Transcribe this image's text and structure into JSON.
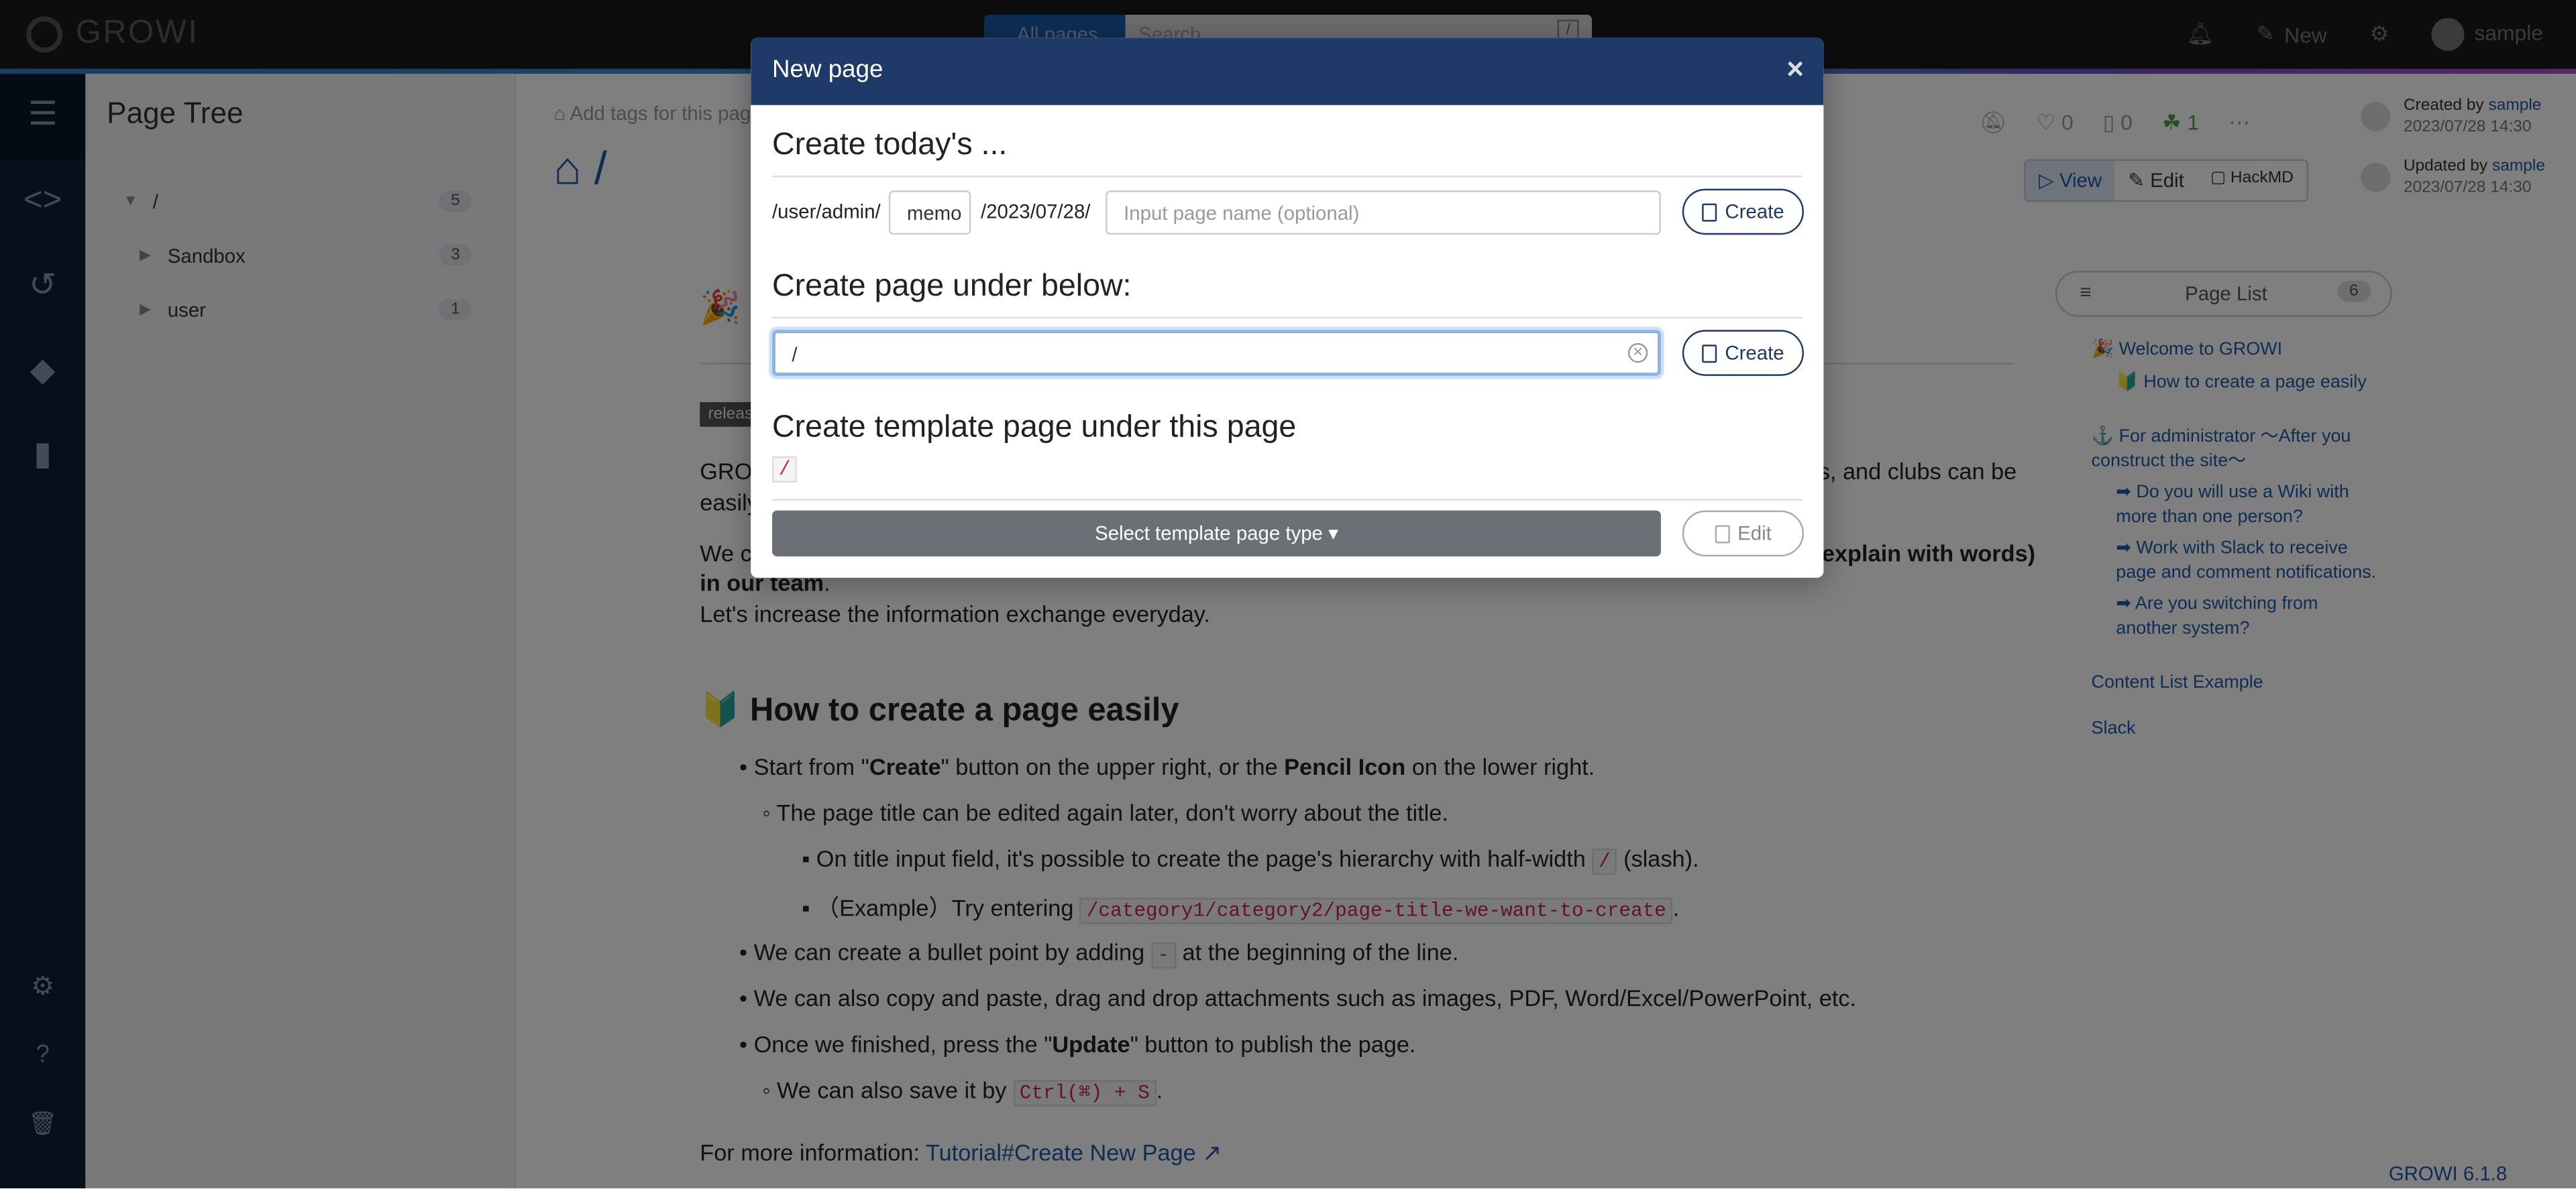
{
  "topnav": {
    "app_name": "GROWI",
    "search_scope": "All pages ▾",
    "search_placeholder": "Search ...",
    "search_shortcut": "/",
    "new_label": "New",
    "user_name": "sample"
  },
  "pagetree": {
    "title": "Page Tree",
    "items": [
      {
        "label": "/",
        "count": "5"
      },
      {
        "label": "Sandbox",
        "count": "3"
      },
      {
        "label": "user",
        "count": "1"
      }
    ]
  },
  "main": {
    "add_tags": "Add tags for this page",
    "path": "/",
    "release_badge": "release",
    "intro_lead": "GROWI",
    "intro_tail": "ies, and clubs can be",
    "intro_line2": "easily",
    "we_lead": "We ca",
    "we_tail": "explain with words)",
    "in_our_team": "in our team",
    "exchange": "Let's increase the information exchange everyday.",
    "h1": "How to create a page easily",
    "bullets": {
      "start_prefix": "Start from \"",
      "start_bold1": "Create",
      "start_mid": "\" button on the upper right, or the ",
      "start_bold2": "Pencil Icon",
      "start_suffix": " on the lower right.",
      "title_edit": "The page title can be edited again later, don't worry about the title.",
      "hierarchy_prefix": "On title input field, it's possible to create the page's hierarchy with half-width ",
      "hierarchy_code": "/",
      "hierarchy_suffix": " (slash).",
      "example_prefix": "（Example）Try entering ",
      "example_code": "/category1/category2/page-title-we-want-to-create",
      "example_suffix": ".",
      "bullet_prefix": "We can create a bullet point by adding ",
      "bullet_code": "-",
      "bullet_suffix": " at the beginning of the line.",
      "copy_paste": "We can also copy and paste, drag and drop attachments such as images, PDF, Word/Excel/PowerPoint, etc.",
      "update_prefix": "Once we finished, press the \"",
      "update_bold": "Update",
      "update_suffix": "\" button to publish the page.",
      "save_prefix": "We can also save it by ",
      "save_code": "Ctrl(⌘) + S",
      "save_suffix": "."
    },
    "more_info_prefix": "For more information: ",
    "more_info_link": "Tutorial#Create New Page"
  },
  "stats": {
    "likes": "0",
    "bookmarks": "0",
    "seen": "1"
  },
  "view_tabs": {
    "view": "View",
    "edit": "Edit",
    "hackmd": "HackMD"
  },
  "meta": {
    "created_label": "Created by",
    "created_user": "sample",
    "created_date": "2023/07/28 14:30",
    "updated_label": "Updated by",
    "updated_user": "sample",
    "updated_date": "2023/07/28 14:30"
  },
  "pagelist": {
    "label": "Page List",
    "count": "6"
  },
  "toc": [
    "🎉 Welcome to GROWI",
    "🔰 How to create a page easily",
    "⚓ For administrator 〜After you construct the site〜",
    "➡ Do you will use a Wiki with more than one person?",
    "➡ Work with Slack to receive page and comment notifications.",
    "➡ Are you switching from another system?",
    "Content List Example",
    "Slack"
  ],
  "version": "GROWI 6.1.8",
  "modal": {
    "title": "New page",
    "close": "×",
    "today_heading": "Create today's ...",
    "today_prefix": "/user/admin/",
    "today_memo": "memo",
    "today_date": "/2023/07/28/",
    "today_placeholder": "Input page name (optional)",
    "create_label": "Create",
    "under_heading": "Create page under below:",
    "under_value": "/",
    "template_heading": "Create template page under this page",
    "template_path": "/",
    "select_template": "Select template page type",
    "edit_label": "Edit"
  },
  "colors": {
    "accent": "#1e3a68",
    "link": "#1d5aa8",
    "sidebar": "#0e1e36"
  }
}
